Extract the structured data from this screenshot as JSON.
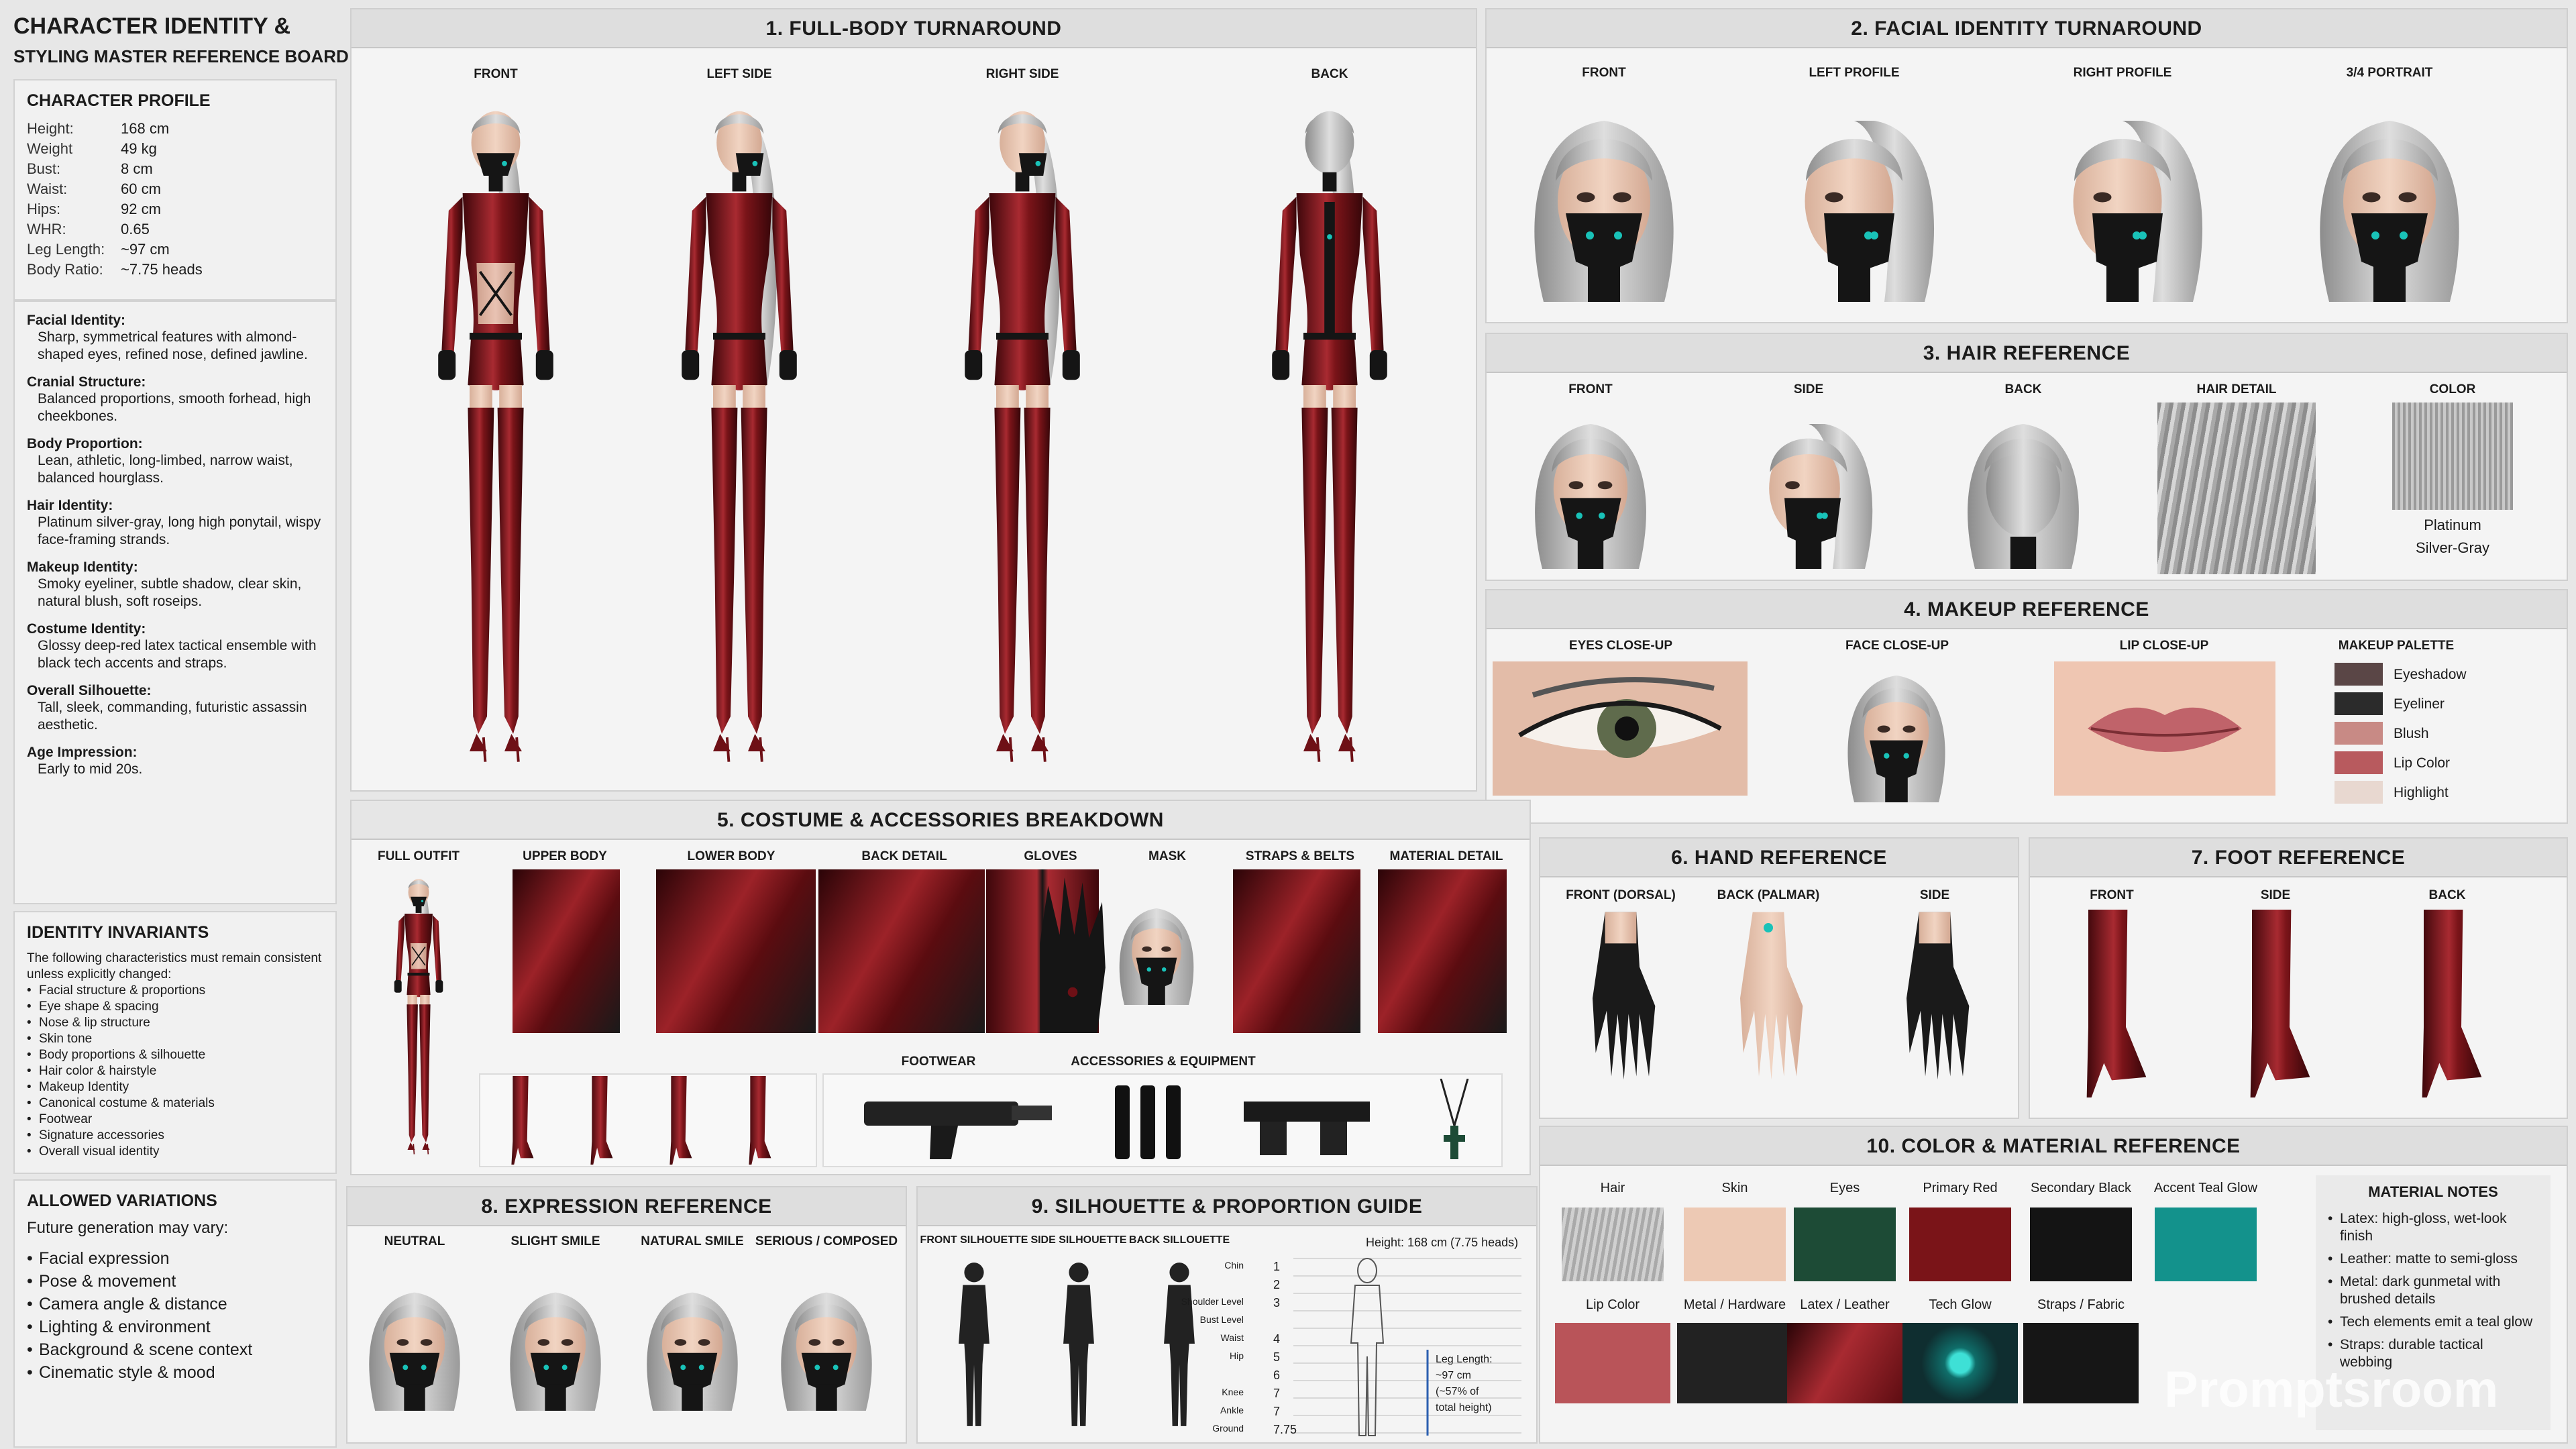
{
  "board_title": {
    "line1": "CHARACTER IDENTITY &",
    "line2": "STYLING MASTER REFERENCE BOARD"
  },
  "profile": {
    "heading": "CHARACTER PROFILE",
    "stats": [
      {
        "k": "Height:",
        "v": "168 cm"
      },
      {
        "k": "Weight",
        "v": "49 kg"
      },
      {
        "k": "Bust:",
        "v": "8 cm"
      },
      {
        "k": "Waist:",
        "v": "60 cm"
      },
      {
        "k": "Hips:",
        "v": "92 cm"
      },
      {
        "k": "WHR:",
        "v": "0.65"
      },
      {
        "k": "Leg Length:",
        "v": "~97 cm"
      },
      {
        "k": "Body Ratio:",
        "v": "~7.75 heads"
      }
    ]
  },
  "identity": [
    {
      "k": "Facial Identity:",
      "v": "Sharp, symmetrical features with almond-shaped eyes, refined nose, defined jawline."
    },
    {
      "k": "Cranial Structure:",
      "v": "Balanced proportions, smooth forhead, high cheekbones."
    },
    {
      "k": "Body Proportion:",
      "v": "Lean, athletic, long-limbed, narrow waist, balanced hourglass."
    },
    {
      "k": "Hair Identity:",
      "v": "Platinum silver-gray, long high ponytail, wispy face-framing strands."
    },
    {
      "k": "Makeup Identity:",
      "v": "Smoky eyeliner, subtle shadow, clear skin, natural blush, soft roseips."
    },
    {
      "k": "Costume Identity:",
      "v": "Glossy deep-red latex tactical ensemble with black tech accents and straps."
    },
    {
      "k": "Overall Silhouette:",
      "v": "Tall, sleek, commanding, futuristic assassin aesthetic."
    },
    {
      "k": "Age Impression:",
      "v": "Early to mid 20s."
    }
  ],
  "invariants": {
    "heading": "IDENTITY INVARIANTS",
    "intro": "The following characteristics must remain consistent unless explicitly changed:",
    "items": [
      "Facial structure & proportions",
      "Eye shape & spacing",
      "Nose & lip structure",
      "Skin tone",
      "Body proportions & silhouette",
      "Hair color & hairstyle",
      "Makeup Identity",
      "Canonical costume & materials",
      "Footwear",
      "Signature accessories",
      "Overall visual identity"
    ]
  },
  "variations": {
    "heading": "ALLOWED VARIATIONS",
    "intro": "Future generation may vary:",
    "items": [
      "Facial expression",
      "Pose & movement",
      "Camera angle & distance",
      "Lighting & environment",
      "Background & scene context",
      "Cinematic style & mood"
    ]
  },
  "s1": {
    "title": "1. FULL-BODY TURNAROUND",
    "labels": [
      "FRONT",
      "LEFT SIDE",
      "RIGHT SIDE",
      "BACK"
    ]
  },
  "s2": {
    "title": "2. FACIAL IDENTITY TURNAROUND",
    "labels": [
      "FRONT",
      "LEFT PROFILE",
      "RIGHT PROFILE",
      "3/4 PORTRAIT"
    ]
  },
  "s3": {
    "title": "3. HAIR REFERENCE",
    "labels": [
      "FRONT",
      "SIDE",
      "BACK",
      "HAIR DETAIL",
      "COLOR"
    ],
    "color_name": "Platinum",
    "color_name2": "Silver-Gray"
  },
  "s4": {
    "title": "4. MAKEUP REFERENCE",
    "labels": [
      "EYES CLOSE-UP",
      "FACE CLOSE-UP",
      "LIP CLOSE-UP",
      "MAKEUP PALETTE"
    ],
    "palette": [
      {
        "name": "Eyeshadow",
        "color": "#5a4646"
      },
      {
        "name": "Eyeliner",
        "color": "#2b2b2b"
      },
      {
        "name": "Blush",
        "color": "#c88a85"
      },
      {
        "name": "Lip Color",
        "color": "#b85a5e"
      },
      {
        "name": "Highlight",
        "color": "#e8d8d0"
      }
    ]
  },
  "s5": {
    "title": "5. COSTUME & ACCESSORIES BREAKDOWN",
    "labels": [
      "FULL OUTFIT",
      "UPPER BODY",
      "LOWER BODY",
      "BACK DETAIL",
      "GLOVES",
      "MASK",
      "STRAPS & BELTS",
      "MATERIAL DETAIL"
    ],
    "footwear": "FOOTWEAR",
    "accessories": "ACCESSORIES & EQUIPMENT"
  },
  "s6": {
    "title": "6. HAND REFERENCE",
    "labels": [
      "FRONT (DORSAL)",
      "BACK (PALMAR)",
      "SIDE"
    ]
  },
  "s7": {
    "title": "7. FOOT REFERENCE",
    "labels": [
      "FRONT",
      "SIDE",
      "BACK"
    ]
  },
  "s8": {
    "title": "8. EXPRESSION REFERENCE",
    "labels": [
      "NEUTRAL",
      "SLIGHT SMILE",
      "NATURAL SMILE",
      "SERIOUS / COMPOSED"
    ]
  },
  "s9": {
    "title": "9. SILHOUETTE & PROPORTION GUIDE",
    "labels": [
      "FRONT SILHOUETTE",
      "SIDE SILHOUETTE",
      "BACK SILLOUETTE"
    ],
    "height_note": "Height: 168 cm (7.75 heads)",
    "markers": [
      {
        "label": "Chin",
        "n": "1"
      },
      {
        "label": "",
        "n": "2"
      },
      {
        "label": "Shoulder Level",
        "n": "3"
      },
      {
        "label": "Bust Level",
        "n": ""
      },
      {
        "label": "Waist",
        "n": "4"
      },
      {
        "label": "Hip",
        "n": "5"
      },
      {
        "label": "",
        "n": "6"
      },
      {
        "label": "Knee",
        "n": "7"
      },
      {
        "label": "Ankle",
        "n": "7"
      },
      {
        "label": "Ground",
        "n": "7.75"
      }
    ],
    "leg_note": [
      "Leg Length:",
      "~97 cm",
      "(~57% of",
      "total height)"
    ]
  },
  "s10": {
    "title": "10. COLOR & MATERIAL REFERENCE",
    "row1": [
      {
        "name": "Hair",
        "color": "#a9a9a9"
      },
      {
        "name": "Skin",
        "color": "#edc9b4"
      },
      {
        "name": "Eyes",
        "color": "#1d4b36"
      },
      {
        "name": "Primary Red",
        "color": "#7a1418"
      },
      {
        "name": "Secondary Black",
        "color": "#141414"
      },
      {
        "name": "Accent Teal Glow",
        "color": "#13928c"
      }
    ],
    "row2": [
      {
        "name": "Lip Color",
        "color": "#b95459"
      },
      {
        "name": "Metal / Hardware",
        "color": "#222222"
      },
      {
        "name": "Latex / Leather",
        "color": "#5e0d12"
      },
      {
        "name": "Tech Glow",
        "color": "#0f2e30"
      },
      {
        "name": "Straps / Fabric",
        "color": "#161616"
      }
    ],
    "notes_title": "MATERIAL NOTES",
    "notes": [
      "Latex: high-gloss, wet-look finish",
      "Leather: matte to semi-gloss",
      "Metal: dark gunmetal with brushed details",
      "Tech elements emit a teal glow",
      "Straps: durable tactical webbing"
    ],
    "watermark": "Promptsroom"
  },
  "colors": {
    "red": "#6e1016",
    "redHi": "#a5262d",
    "black": "#151515",
    "teal": "#19c2b8",
    "skin": "#e9c8b4",
    "hair": "#b8b8b8"
  }
}
